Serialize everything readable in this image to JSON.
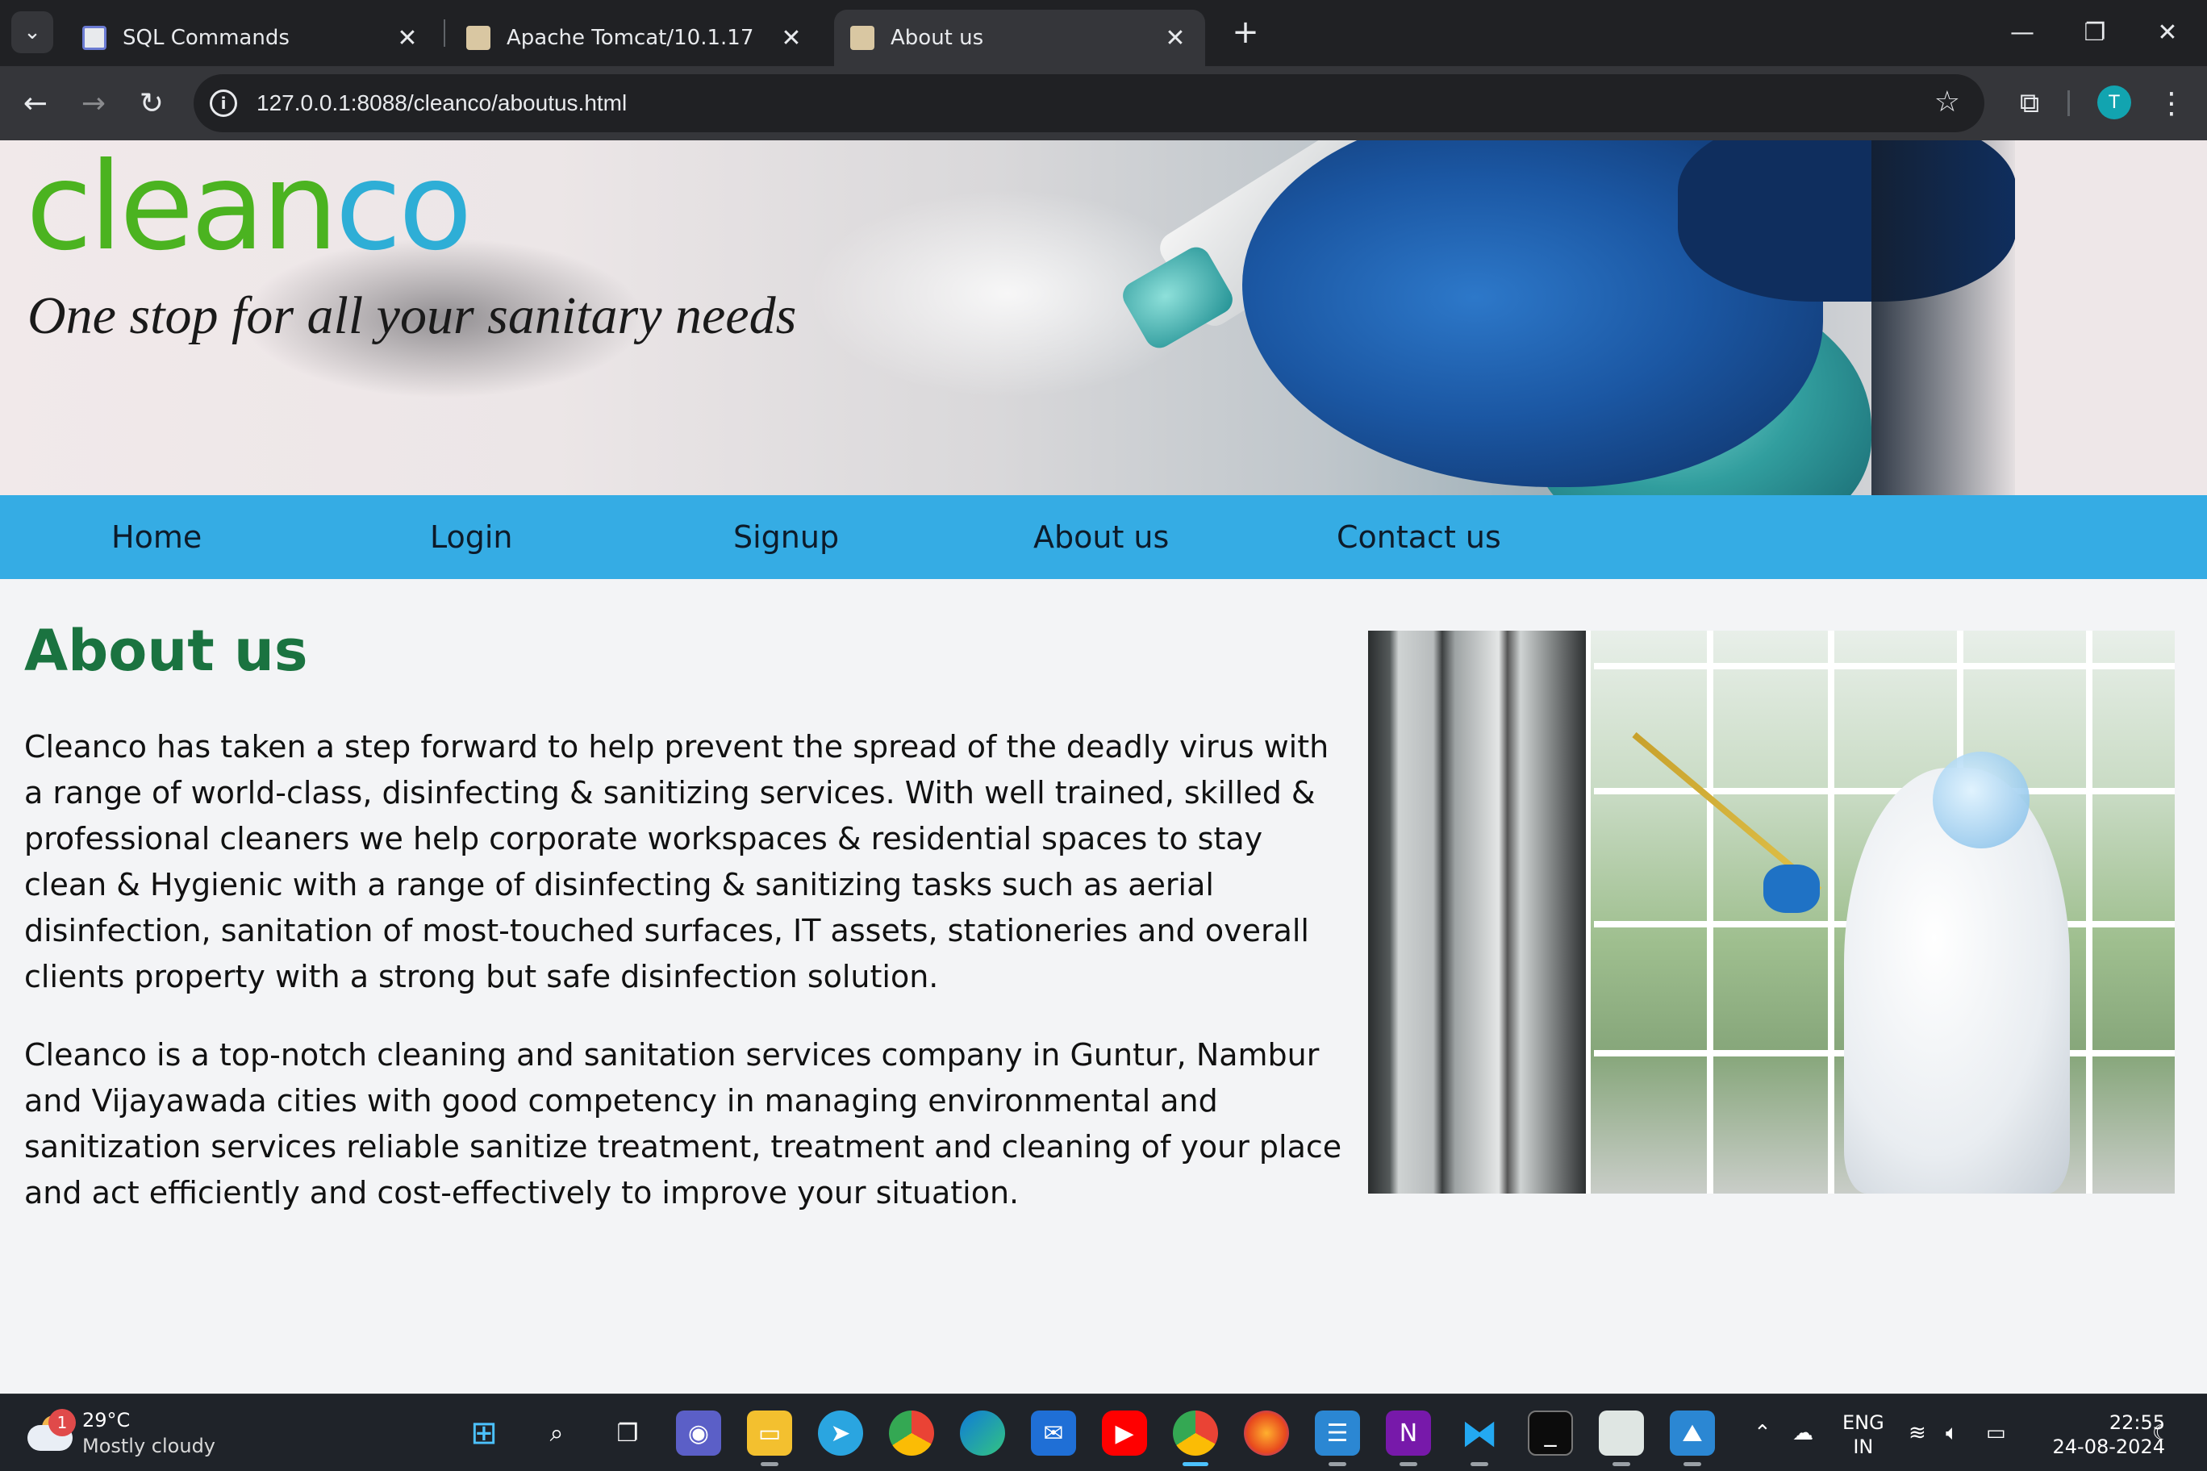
{
  "browser": {
    "tabs": [
      {
        "title": "SQL Commands",
        "active": false
      },
      {
        "title": "Apache Tomcat/10.1.17",
        "active": false
      },
      {
        "title": "About us",
        "active": true
      }
    ],
    "url": "127.0.0.1:8088/cleanco/aboutus.html",
    "profile_initial": "T",
    "icons": {
      "tab_search": "chevron-down-icon",
      "close": "close-icon",
      "new_tab": "plus-icon",
      "back": "back-arrow-icon",
      "forward": "forward-arrow-icon",
      "reload": "reload-icon",
      "site_info": "info-icon",
      "bookmark": "star-icon",
      "extensions": "puzzle-icon",
      "menu": "kebab-menu-icon"
    }
  },
  "site": {
    "logo": {
      "part1": "clean",
      "part2": "co"
    },
    "tagline": "One stop for all your sanitary needs",
    "nav": [
      "Home",
      "Login",
      "Signup",
      "About us",
      "Contact us"
    ],
    "colors": {
      "nav_bg": "#35ace4",
      "logo_green": "#4bb320",
      "logo_blue": "#2eaed6",
      "heading": "#1a7340"
    }
  },
  "content": {
    "title": "About us",
    "paragraphs": [
      "Cleanco has taken a step forward to help prevent the spread of the deadly virus with a range of world-class, disinfecting & sanitizing services. With well trained, skilled & professional cleaners we help corporate workspaces & residential spaces to stay clean & Hygienic with a range of disinfecting & sanitizing tasks such as aerial disinfection, sanitation of most-touched surfaces, IT assets, stationeries and overall clients property with a strong but safe disinfection solution.",
      "Cleanco is a top-notch cleaning and sanitation services company in Guntur, Nambur and Vijayawada cities with good competency in managing environmental and sanitization services reliable sanitize treatment, treatment and cleaning of your place and act efficiently and cost-effectively to improve your situation."
    ]
  },
  "taskbar": {
    "weather": {
      "temp": "29°C",
      "condition": "Mostly cloudy",
      "badge": "1"
    },
    "language": {
      "line1": "ENG",
      "line2": "IN"
    },
    "clock": {
      "time": "22:55",
      "date": "24-08-2024"
    }
  }
}
